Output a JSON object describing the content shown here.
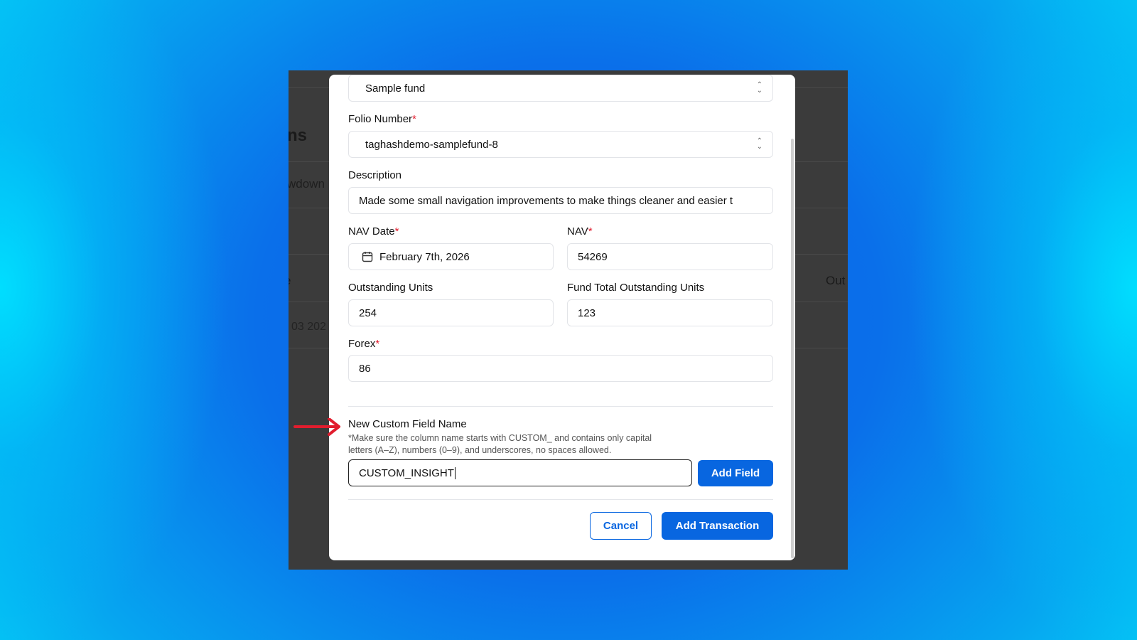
{
  "background_app": {
    "heading_fragment": "ns",
    "tab_fragment": "wdown",
    "column_fragment_left": "e",
    "column_fragment_right": "Out",
    "cell_fragment": "03 202"
  },
  "modal": {
    "fund": {
      "value": "Sample fund"
    },
    "folio": {
      "label": "Folio Number",
      "value": "taghashdemo-samplefund-8"
    },
    "description": {
      "label": "Description",
      "value": "Made some small navigation improvements to make things cleaner and easier t"
    },
    "nav_date": {
      "label": "NAV Date",
      "value": "February 7th, 2026"
    },
    "nav": {
      "label": "NAV",
      "value": "54269"
    },
    "outstanding_units": {
      "label": "Outstanding Units",
      "value": "254"
    },
    "fund_total_units": {
      "label": "Fund Total Outstanding Units",
      "value": "123"
    },
    "forex": {
      "label": "Forex",
      "value": "86"
    },
    "custom_field": {
      "label": "New Custom Field Name",
      "hint_line1": "*Make sure the column name starts with CUSTOM_ and contains only capital",
      "hint_line2": "letters (A–Z), numbers (0–9), and underscores, no spaces allowed.",
      "value": "CUSTOM_INSIGHT",
      "add_button": "Add Field"
    },
    "footer": {
      "cancel": "Cancel",
      "submit": "Add Transaction"
    },
    "required_marker": "*"
  },
  "colors": {
    "primary": "#0866e0",
    "required": "#e11d2e",
    "annotation_arrow": "#e11d2e"
  },
  "icons": {
    "calendar": "calendar-icon",
    "select": "chevron-updown-icon",
    "annotation": "arrow-right-icon"
  }
}
